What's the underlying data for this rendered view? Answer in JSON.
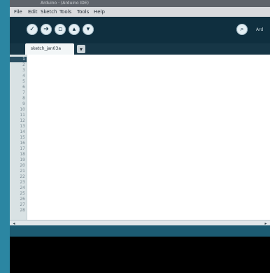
{
  "window": {
    "title": "Arduino  ·  (Arduino IDE)"
  },
  "menu": [
    "File",
    "Edit",
    "Sketch",
    "Tools",
    "Tools",
    "Help"
  ],
  "toolbar": {
    "icons": [
      "verify-icon",
      "upload-icon",
      "new-icon",
      "open-icon",
      "save-icon",
      "serial-monitor-icon"
    ],
    "right_label": "Ard"
  },
  "tabs": [
    {
      "label": "sketch_jan03a"
    }
  ],
  "editor": {
    "line_numbers": [
      "1",
      "2",
      "3",
      "4",
      "5",
      "6",
      "7",
      "8",
      "9",
      "10",
      "11",
      "12",
      "13",
      "14",
      "15",
      "16",
      "17",
      "18",
      "19",
      "20",
      "21",
      "22",
      "23",
      "24",
      "25",
      "26",
      "27",
      "28"
    ]
  }
}
